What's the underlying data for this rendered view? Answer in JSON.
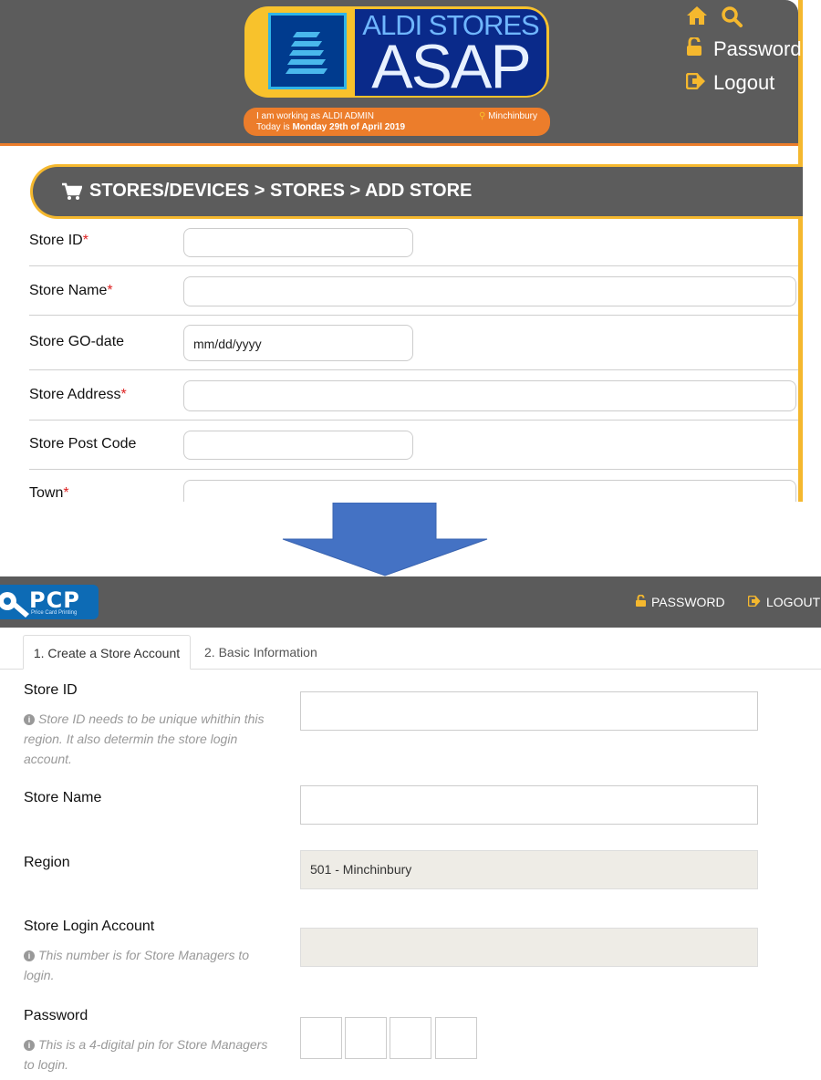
{
  "top": {
    "logo": {
      "line1": "ALDI STORES",
      "line2": "ASAP"
    },
    "status": {
      "working_as": "I am working as ALDI ADMIN",
      "today_prefix": "Today is ",
      "today_date": "Monday 29th of April 2019",
      "location": "Minchinbury"
    },
    "nav": {
      "password": "Password",
      "logout": "Logout"
    },
    "breadcrumb": "STORES/DEVICES > STORES > ADD STORE",
    "form": {
      "store_id": "Store ID",
      "store_name": "Store Name",
      "store_go_date": "Store GO-date",
      "go_date_placeholder": "mm/dd/yyyy",
      "store_address": "Store Address",
      "store_post_code": "Store Post Code",
      "town": "Town",
      "required_mark": "*"
    }
  },
  "bottom": {
    "logo": {
      "text": "PCP",
      "sub": "Price Card Printing"
    },
    "nav": {
      "password": "PASSWORD",
      "logout": "LOGOUT"
    },
    "tabs": [
      {
        "label": "1. Create a Store Account",
        "active": true
      },
      {
        "label": "2. Basic Information",
        "active": false
      }
    ],
    "form": {
      "store_id": {
        "label": "Store ID",
        "help": "Store ID needs to be unique whithin this region. It also determin the store login account.",
        "value": ""
      },
      "store_name": {
        "label": "Store Name",
        "value": ""
      },
      "region": {
        "label": "Region",
        "value": "501 - Minchinbury"
      },
      "store_login_account": {
        "label": "Store Login Account",
        "help": "This number is for Store Managers to login.",
        "value": ""
      },
      "password": {
        "label": "Password",
        "help": "This is a 4-digital pin for Store Managers to login.",
        "pin_boxes": 4
      }
    }
  },
  "colors": {
    "header_gray": "#5c5c5c",
    "aldi_orange": "#ec7d2b",
    "aldi_yellow": "#f5b82e",
    "aldi_navy": "#0a2a8a",
    "pcp_blue": "#0d6bb5",
    "arrow_blue": "#4472c4",
    "required_red": "#d22222"
  },
  "icons": [
    "home-icon",
    "search-icon",
    "lock-icon",
    "logout-icon",
    "cart-icon",
    "location-pin-icon",
    "info-icon",
    "key-icon",
    "down-arrow"
  ]
}
